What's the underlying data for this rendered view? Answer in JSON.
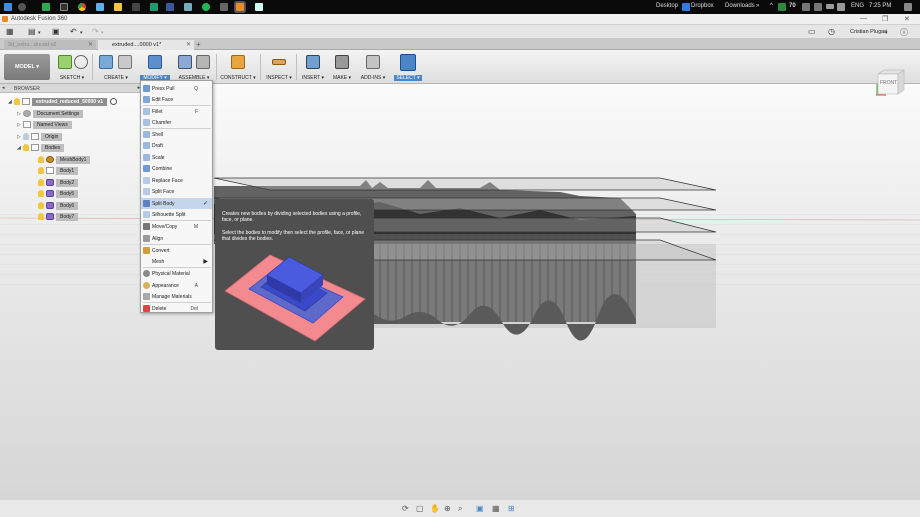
{
  "taskbar": {
    "desktop_label": "Desktop",
    "dropbox_label": "Dropbox",
    "downloads_label": "Downloads",
    "chevron": "»",
    "badge": "70",
    "lang": "ENG",
    "time": "7:25 PM"
  },
  "app": {
    "title": "Autodesk Fusion 360",
    "user_name": "Cristian Plugari"
  },
  "tabs": {
    "inactive_label": "3d_extru...duced v2",
    "active_label": "extruded....0000 v1*"
  },
  "ribbon": {
    "workspace_label": "MODEL",
    "groups": {
      "sketch": "SKETCH ▾",
      "create": "CREATE ▾",
      "modify": "MODIFY ▾",
      "assemble": "ASSEMBLE ▾",
      "construct": "CONSTRUCT ▾",
      "inspect": "INSPECT ▾",
      "insert": "INSERT ▾",
      "make": "MAKE ▾",
      "addins": "ADD-INS ▾",
      "select": "SELECT ▾"
    }
  },
  "browser": {
    "header": "BROWSER",
    "root_label": "extruded_reduced_50000 v1",
    "items": {
      "doc_settings": "Document Settings",
      "named_views": "Named Views",
      "origin": "Origin",
      "bodies": "Bodies",
      "meshbody": "MeshBody1",
      "body1": "Body1",
      "body2": "Body2",
      "body5": "Body5",
      "body6": "Body6",
      "body7": "Body7"
    }
  },
  "modify_menu": {
    "press_pull": "Press Pull",
    "press_pull_key": "Q",
    "edit_face": "Edit Face",
    "fillet": "Fillet",
    "fillet_key": "F",
    "chamfer": "Chamfer",
    "shell": "Shell",
    "draft": "Draft",
    "scale": "Scale",
    "combine": "Combine",
    "replace_face": "Replace Face",
    "split_face": "Split Face",
    "split_body": "Split Body",
    "silhouette_split": "Silhouette Split",
    "move_copy": "Move/Copy",
    "move_copy_key": "M",
    "align": "Align",
    "convert": "Convert",
    "mesh": "Mesh",
    "physical_material": "Physical Material",
    "appearance": "Appearance",
    "appearance_key": "A",
    "manage_materials": "Manage Materials",
    "delete": "Delete",
    "delete_key": "Del"
  },
  "tooltip": {
    "line1": "Creates new bodies by dividing selected bodies using a profile, face, or plane.",
    "line2": "Select the bodies to modify then select the profile, face, or plane that divides the bodies."
  },
  "viewcube": {
    "face_label": "FRONT"
  },
  "colors": {
    "accent_blue": "#4b87c6",
    "tooltip_bg": "#4f4f4f",
    "split_pink": "#f28a8f",
    "split_blue": "#3a49c9"
  }
}
